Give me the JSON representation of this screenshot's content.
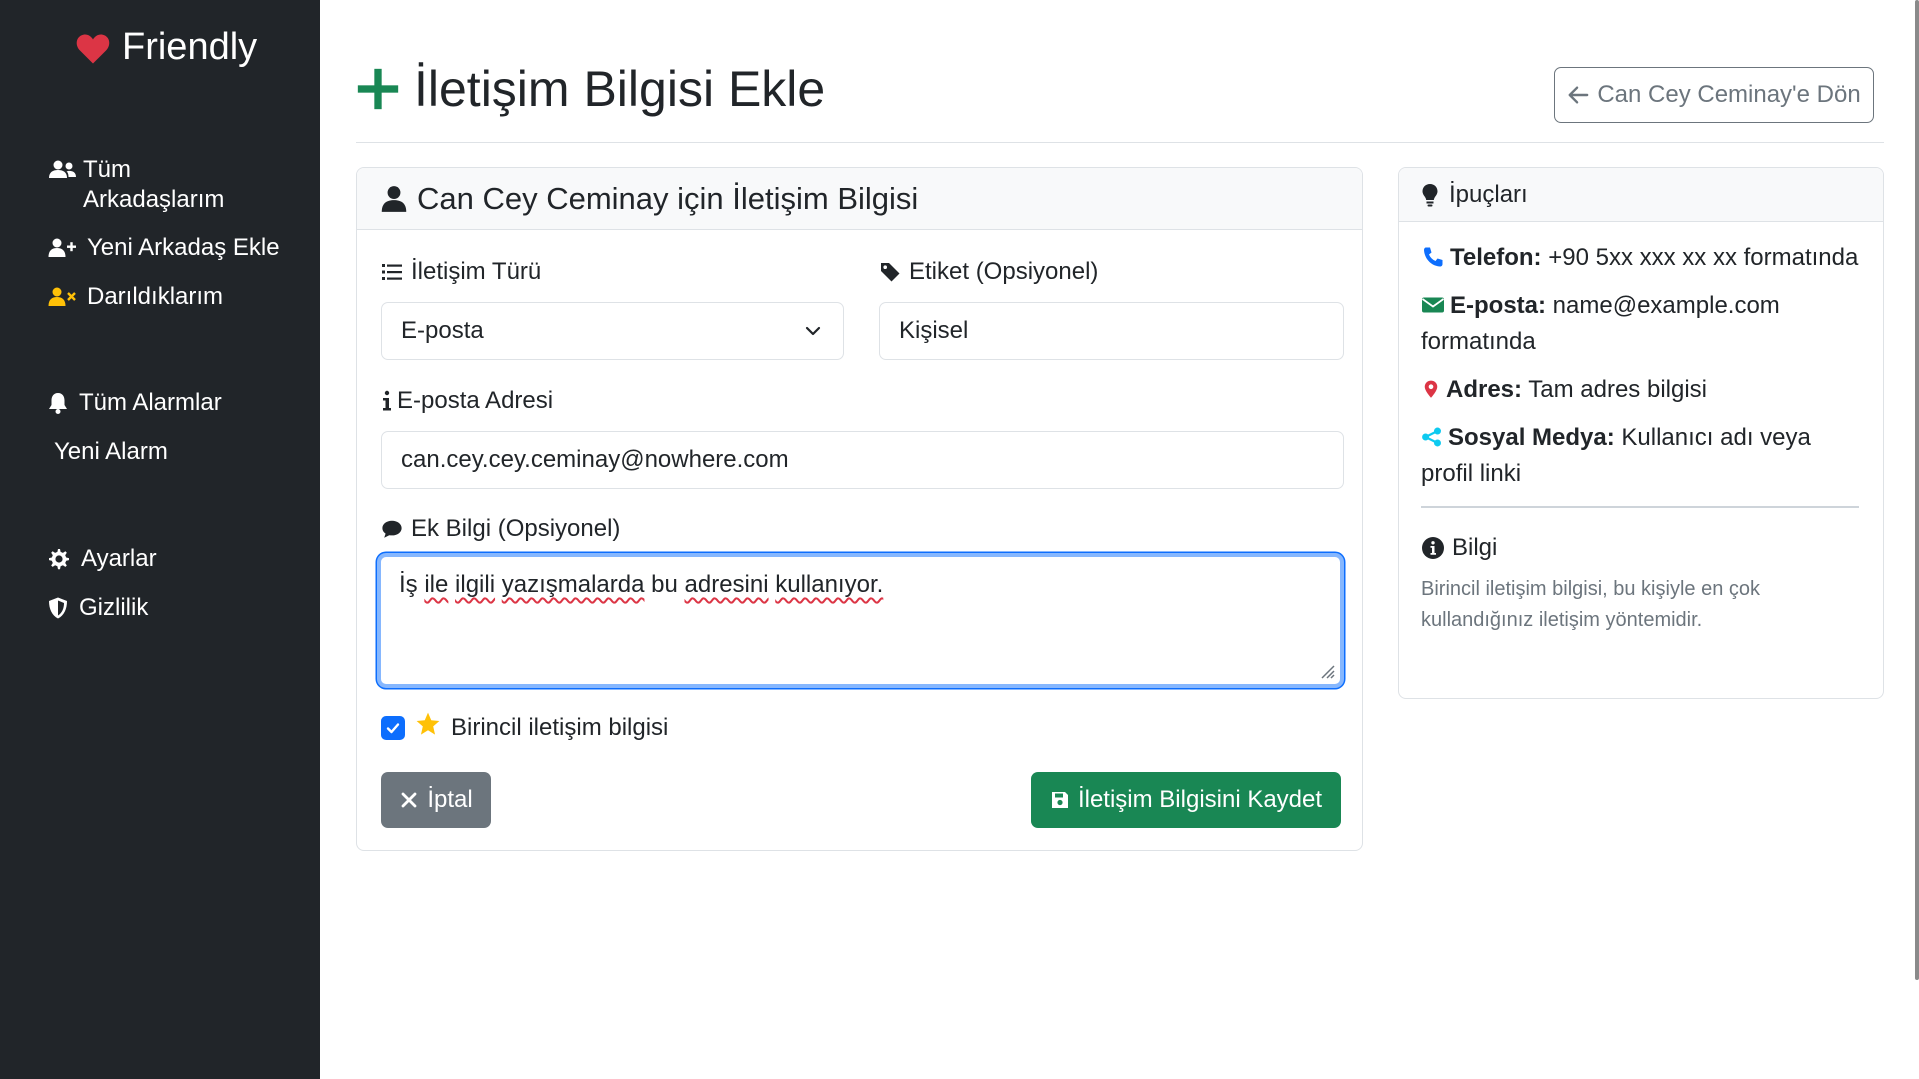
{
  "brand": {
    "name": "Friendly",
    "icon": "heart-icon",
    "icon_color": "#dc3545"
  },
  "sidebar": {
    "items": [
      {
        "label": "Tüm Arkadaşlarım",
        "icon": "users-icon"
      },
      {
        "label": "Yeni Arkadaş Ekle",
        "icon": "user-plus-icon"
      },
      {
        "label": "Darıldıklarım",
        "icon": "user-times-icon",
        "icon_color": "#ffc107"
      },
      {
        "label": "Tüm Alarmlar",
        "icon": "bell-icon"
      },
      {
        "label": "Yeni Alarm",
        "icon": ""
      },
      {
        "label": "Ayarlar",
        "icon": "gear-icon"
      },
      {
        "label": "Gizlilik",
        "icon": "shield-icon"
      }
    ]
  },
  "header": {
    "title": "İletişim Bilgisi Ekle",
    "title_icon": "plus-icon",
    "title_icon_color": "#198754",
    "back_label": "Can Cey Ceminay'e Dön"
  },
  "form": {
    "card_title": "Can Cey Ceminay için İletişim Bilgisi",
    "type_label": "İletişim Türü",
    "type_value": "E-posta",
    "tag_label": "Etiket (Opsiyonel)",
    "tag_value": "Kişisel",
    "email_label": "E-posta Adresi",
    "email_value": "can.cey.cey.ceminay@nowhere.com",
    "note_label": "Ek Bilgi (Opsiyonel)",
    "note_words": [
      "İş",
      "ile",
      "ilgili",
      "yazışmalarda",
      "bu",
      "adresini",
      "kullanıyor."
    ],
    "primary_label": "Birincil iletişim bilgisi",
    "primary_checked": true,
    "cancel_label": "İptal",
    "save_label": "İletişim Bilgisini Kaydet"
  },
  "tips": {
    "title": "İpuçları",
    "items": [
      {
        "key": "Telefon:",
        "text": "+90 5xx xxx xx xx formatında",
        "icon": "phone-icon",
        "icon_color": "#0d6efd"
      },
      {
        "key": "E-posta:",
        "text": "name@example.com formatında",
        "icon": "envelope-icon",
        "icon_color": "#198754"
      },
      {
        "key": "Adres:",
        "text": "Tam adres bilgisi",
        "icon": "map-marker-icon",
        "icon_color": "#dc3545"
      },
      {
        "key": "Sosyal Medya:",
        "text": "Kullanıcı adı veya profil linki",
        "icon": "share-icon",
        "icon_color": "#0dcaf0"
      }
    ],
    "info_title": "Bilgi",
    "info_text": "Birincil iletişim bilgisi, bu kişiyle en çok kullandığınız iletişim yöntemidir."
  },
  "colors": {
    "sidebar_bg": "#212529",
    "primary": "#0d6efd",
    "success": "#198754",
    "secondary": "#6c757d"
  }
}
